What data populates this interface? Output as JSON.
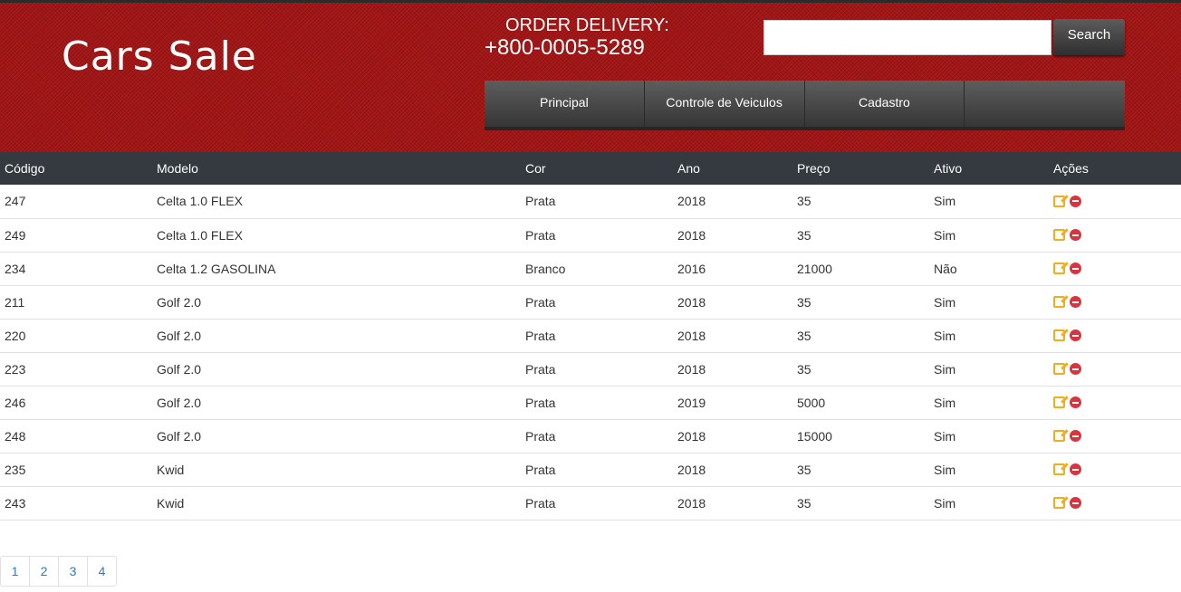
{
  "header": {
    "logo": "Cars Sale",
    "delivery_label": "ORDER DELIVERY:",
    "delivery_phone": "+800-0005-5289",
    "search_placeholder": "",
    "search_button": "Search",
    "brand_color": "#a11414"
  },
  "nav": {
    "items": [
      {
        "label": "Principal"
      },
      {
        "label": "Controle de Veiculos"
      },
      {
        "label": "Cadastro"
      },
      {
        "label": ""
      }
    ]
  },
  "table": {
    "headers": [
      "Código",
      "Modelo",
      "Cor",
      "Ano",
      "Preço",
      "Ativo",
      "Ações"
    ],
    "rows": [
      {
        "codigo": "247",
        "modelo": "Celta 1.0 FLEX",
        "cor": "Prata",
        "ano": "2018",
        "preco": "35",
        "ativo": "Sim"
      },
      {
        "codigo": "249",
        "modelo": "Celta 1.0 FLEX",
        "cor": "Prata",
        "ano": "2018",
        "preco": "35",
        "ativo": "Sim"
      },
      {
        "codigo": "234",
        "modelo": "Celta 1.2 GASOLINA",
        "cor": "Branco",
        "ano": "2016",
        "preco": "21000",
        "ativo": "Não"
      },
      {
        "codigo": "211",
        "modelo": "Golf 2.0",
        "cor": "Prata",
        "ano": "2018",
        "preco": "35",
        "ativo": "Sim"
      },
      {
        "codigo": "220",
        "modelo": "Golf 2.0",
        "cor": "Prata",
        "ano": "2018",
        "preco": "35",
        "ativo": "Sim"
      },
      {
        "codigo": "223",
        "modelo": "Golf 2.0",
        "cor": "Prata",
        "ano": "2018",
        "preco": "35",
        "ativo": "Sim"
      },
      {
        "codigo": "246",
        "modelo": "Golf 2.0",
        "cor": "Prata",
        "ano": "2019",
        "preco": "5000",
        "ativo": "Sim"
      },
      {
        "codigo": "248",
        "modelo": "Golf 2.0",
        "cor": "Prata",
        "ano": "2018",
        "preco": "15000",
        "ativo": "Sim"
      },
      {
        "codigo": "235",
        "modelo": "Kwid",
        "cor": "Prata",
        "ano": "2018",
        "preco": "35",
        "ativo": "Sim"
      },
      {
        "codigo": "243",
        "modelo": "Kwid",
        "cor": "Prata",
        "ano": "2018",
        "preco": "35",
        "ativo": "Sim"
      }
    ],
    "action_icons": [
      "edit-icon",
      "delete-icon"
    ],
    "edit_color": "#f0ad1e",
    "delete_color": "#d9343f"
  },
  "pagination": {
    "pages": [
      "1",
      "2",
      "3",
      "4"
    ]
  }
}
